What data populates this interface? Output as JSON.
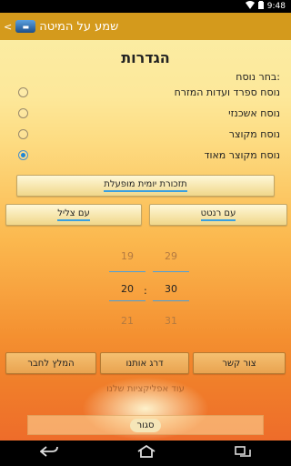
{
  "status": {
    "time": "9:48"
  },
  "header": {
    "title": "שמע על המיטה",
    "app_icon": "bed-app-icon"
  },
  "settings": {
    "title": "הגדרות",
    "choose_label": "בחר נוסח:",
    "options": [
      {
        "label": "נוסח ספרד ועדות המזרח",
        "checked": false
      },
      {
        "label": "נוסח אשכנזי",
        "checked": false
      },
      {
        "label": "נוסח מקוצר",
        "checked": false
      },
      {
        "label": "נוסח מקוצר מאוד",
        "checked": true
      }
    ],
    "reminder_label": "תזכורת יומית מופעלת",
    "with_ringtone": "עם רנטט",
    "with_ring": "עם צליל"
  },
  "picker": {
    "hours": {
      "above": "29",
      "selected": "30",
      "below": "31"
    },
    "minutes": {
      "above": "19",
      "selected": "20",
      "below": "21"
    },
    "separator": ":"
  },
  "actions": {
    "contact": "צור קשר",
    "rate": "דרג אותנו",
    "recommend": "המלץ לחבר",
    "more_apps": "עוד אפליקציות שלנו",
    "close": "סגור"
  },
  "colors": {
    "accent": "#1f86d6",
    "actionbar": "#d49a1c"
  }
}
